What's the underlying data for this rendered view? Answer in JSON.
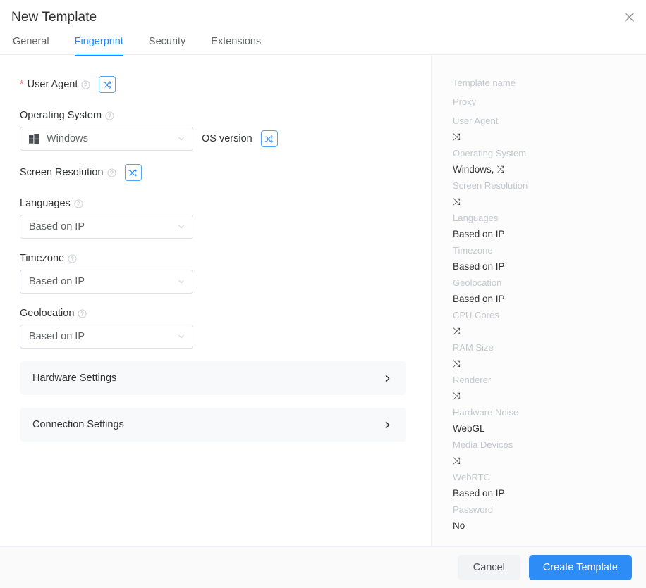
{
  "header": {
    "title": "New Template",
    "close_icon": "close-icon",
    "tabs": [
      {
        "label": "General",
        "active": false
      },
      {
        "label": "Fingerprint",
        "active": true
      },
      {
        "label": "Security",
        "active": false
      },
      {
        "label": "Extensions",
        "active": false
      }
    ]
  },
  "colors": {
    "accent": "#1a8cff",
    "primary_button": "#2d8cf5",
    "required_star": "#f56c6c",
    "panel_bg": "#fcfcfd",
    "accordion_bg": "#f8f9fa"
  },
  "form": {
    "user_agent": {
      "label": "User Agent",
      "required_marker": "*",
      "help_icon": "help-circle-icon",
      "shuffle_icon": "shuffle-icon"
    },
    "operating_system": {
      "label": "Operating System",
      "help_icon": "help-circle-icon",
      "value": "Windows",
      "os_icon": "windows-logo-icon",
      "caret_icon": "chevron-down-icon",
      "os_version_label": "OS version",
      "os_version_shuffle_icon": "shuffle-icon"
    },
    "screen_resolution": {
      "label": "Screen Resolution",
      "help_icon": "help-circle-icon",
      "shuffle_icon": "shuffle-icon"
    },
    "languages": {
      "label": "Languages",
      "help_icon": "help-circle-icon",
      "value": "Based on IP",
      "caret_icon": "chevron-down-icon"
    },
    "timezone": {
      "label": "Timezone",
      "help_icon": "help-circle-icon",
      "value": "Based on IP",
      "caret_icon": "chevron-down-icon"
    },
    "geolocation": {
      "label": "Geolocation",
      "help_icon": "help-circle-icon",
      "value": "Based on IP",
      "caret_icon": "chevron-down-icon"
    },
    "accordions": [
      {
        "label": "Hardware Settings",
        "chevron_icon": "chevron-right-icon"
      },
      {
        "label": "Connection Settings",
        "chevron_icon": "chevron-right-icon"
      }
    ]
  },
  "summary": {
    "rows": [
      {
        "label": "Template name",
        "value": ""
      },
      {
        "label": "Proxy",
        "value": ""
      },
      {
        "label": "User Agent",
        "value": "⤨"
      },
      {
        "label": "Operating System",
        "value": "Windows, ⤨"
      },
      {
        "label": "Screen Resolution",
        "value": "⤨"
      },
      {
        "label": "Languages",
        "value": "Based on IP"
      },
      {
        "label": "Timezone",
        "value": "Based on IP"
      },
      {
        "label": "Geolocation",
        "value": "Based on IP"
      },
      {
        "label": "CPU Cores",
        "value": "⤨"
      },
      {
        "label": "RAM Size",
        "value": "⤨"
      },
      {
        "label": "Renderer",
        "value": "⤨"
      },
      {
        "label": "Hardware Noise",
        "value": "WebGL"
      },
      {
        "label": "Media Devices",
        "value": "⤨"
      },
      {
        "label": "WebRTC",
        "value": "Based on IP"
      },
      {
        "label": "Password",
        "value": "No"
      }
    ]
  },
  "footer": {
    "cancel_label": "Cancel",
    "create_label": "Create Template"
  }
}
